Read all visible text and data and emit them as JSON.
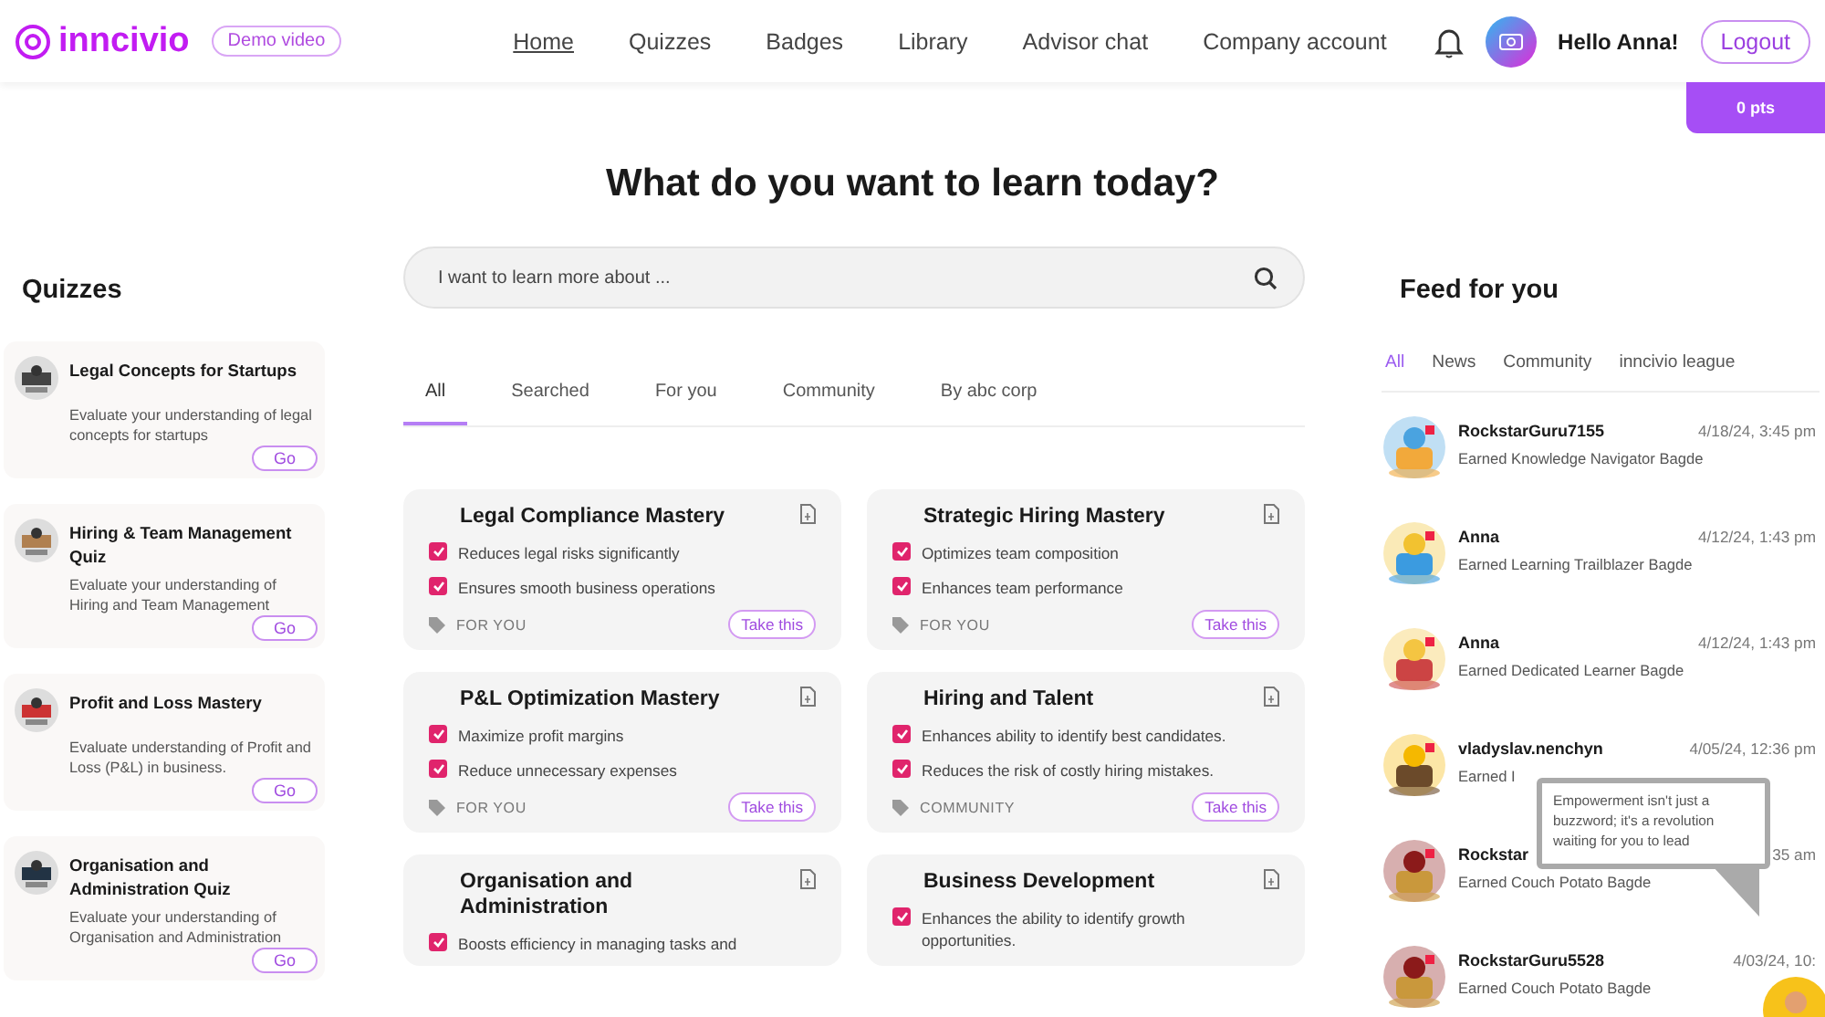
{
  "header": {
    "logo": "inncivio",
    "demo_button": "Demo video",
    "nav": [
      {
        "label": "Home",
        "selected": true
      },
      {
        "label": "Quizzes",
        "selected": false
      },
      {
        "label": "Badges",
        "selected": false
      },
      {
        "label": "Library",
        "selected": false
      },
      {
        "label": "Advisor chat",
        "selected": false
      },
      {
        "label": "Company account",
        "selected": false
      }
    ],
    "greeting": "Hello Anna!",
    "logout": "Logout",
    "points": "0 pts"
  },
  "heading": "What do you want to learn today?",
  "search": {
    "placeholder": "I want to learn more about ..."
  },
  "quizzes": {
    "title": "Quizzes",
    "items": [
      {
        "title": "Legal Concepts for Startups",
        "description": "Evaluate your understanding of legal concepts for startups",
        "button": "Go"
      },
      {
        "title": "Hiring & Team Management Quiz",
        "description": "Evaluate your understanding of Hiring and Team Management",
        "button": "Go"
      },
      {
        "title": "Profit and Loss Mastery",
        "description": "Evaluate understanding of Profit and Loss (P&L) in business.",
        "button": "Go"
      },
      {
        "title": "Organisation and Administration Quiz",
        "description": "Evaluate your understanding of Organisation and Administration",
        "button": "Go"
      }
    ]
  },
  "tabs": [
    {
      "label": "All",
      "selected": true
    },
    {
      "label": "Searched",
      "selected": false
    },
    {
      "label": "For you",
      "selected": false
    },
    {
      "label": "Community",
      "selected": false
    },
    {
      "label": "By abc corp",
      "selected": false
    }
  ],
  "courses": [
    {
      "title": "Legal Compliance Mastery",
      "benefits": [
        {
          "text": "Reduces legal risks significantly",
          "checked": true
        },
        {
          "text": "Ensures smooth business operations",
          "checked": true
        }
      ],
      "tag": "FOR YOU",
      "button": "Take this"
    },
    {
      "title": "Strategic Hiring Mastery",
      "benefits": [
        {
          "text": "Optimizes team composition",
          "checked": true
        },
        {
          "text": "Enhances team performance",
          "checked": true
        }
      ],
      "tag": "FOR YOU",
      "button": "Take this"
    },
    {
      "title": "P&L Optimization Mastery",
      "benefits": [
        {
          "text": "Maximize profit margins",
          "checked": true
        },
        {
          "text": "Reduce unnecessary expenses",
          "checked": true
        }
      ],
      "tag": "FOR YOU",
      "button": "Take this"
    },
    {
      "title": "Hiring and Talent",
      "benefits": [
        {
          "text": "Enhances ability to identify best candidates.",
          "checked": true
        },
        {
          "text": "Reduces the risk of costly hiring mistakes.",
          "checked": true
        }
      ],
      "tag": "COMMUNITY",
      "button": "Take this"
    },
    {
      "title": "Organisation and Administration",
      "benefits": [
        {
          "text": "Boosts efficiency in managing tasks and",
          "checked": true
        }
      ]
    },
    {
      "title": "Business Development",
      "benefits": [
        {
          "text": "Enhances the ability to identify growth opportunities.",
          "checked": true
        }
      ]
    }
  ],
  "feed": {
    "title": "Feed for you",
    "tabs": [
      {
        "label": "All",
        "selected": true
      },
      {
        "label": "News",
        "selected": false
      },
      {
        "label": "Community",
        "selected": false
      },
      {
        "label": "inncivio league",
        "selected": false
      }
    ],
    "items": [
      {
        "user": "RockstarGuru7155",
        "date": "4/18/24, 3:45 pm",
        "text": "Earned Knowledge Navigator Bagde"
      },
      {
        "user": "Anna",
        "date": "4/12/24, 1:43 pm",
        "text": "Earned Learning Trailblazer Bagde"
      },
      {
        "user": "Anna",
        "date": "4/12/24, 1:43 pm",
        "text": "Earned Dedicated Learner Bagde"
      },
      {
        "user": "vladyslav.nenchyn",
        "date": "4/05/24, 12:36 pm",
        "text": "Earned I"
      },
      {
        "user": "Rockstar",
        "date": "35 am",
        "text": "Earned Couch Potato Bagde"
      },
      {
        "user": "RockstarGuru5528",
        "date": "4/03/24, 10:",
        "text": "Earned Couch Potato Bagde"
      }
    ]
  },
  "advisor_bubble": "Empowerment isn't just a buzzword; it's a revolution waiting for you to lead"
}
